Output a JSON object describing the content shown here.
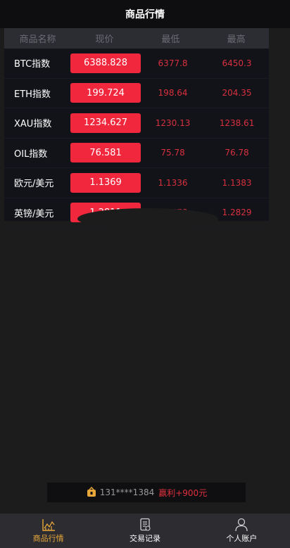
{
  "header": {
    "title": "商品行情"
  },
  "table": {
    "columns": [
      "商品名称",
      "现价",
      "最低",
      "最高"
    ],
    "rows": [
      {
        "name": "BTC指数",
        "price": "6388.828",
        "low": "6377.8",
        "high": "6450.3"
      },
      {
        "name": "ETH指数",
        "price": "199.724",
        "low": "198.64",
        "high": "204.35"
      },
      {
        "name": "XAU指数",
        "price": "1234.627",
        "low": "1230.13",
        "high": "1238.61"
      },
      {
        "name": "OIL指数",
        "price": "76.581",
        "low": "75.78",
        "high": "76.78"
      },
      {
        "name": "欧元/美元",
        "price": "1.1369",
        "low": "1.1336",
        "high": "1.1383"
      },
      {
        "name": "英镑/美元",
        "price": "1.2811",
        "low": "1.2778",
        "high": "1.2829"
      }
    ]
  },
  "ticker": {
    "user": "131****1384",
    "profit": "赢利+900元",
    "icon": "trophy-icon"
  },
  "tabs": [
    {
      "label": "商品行情",
      "icon": "chart-icon",
      "active": true
    },
    {
      "label": "交易记录",
      "icon": "document-icon",
      "active": false
    },
    {
      "label": "个人账户",
      "icon": "user-icon",
      "active": false
    }
  ],
  "colors": {
    "accent": "#e8a73a",
    "price_bg": "#f0273d",
    "red_text": "#d8303f"
  }
}
